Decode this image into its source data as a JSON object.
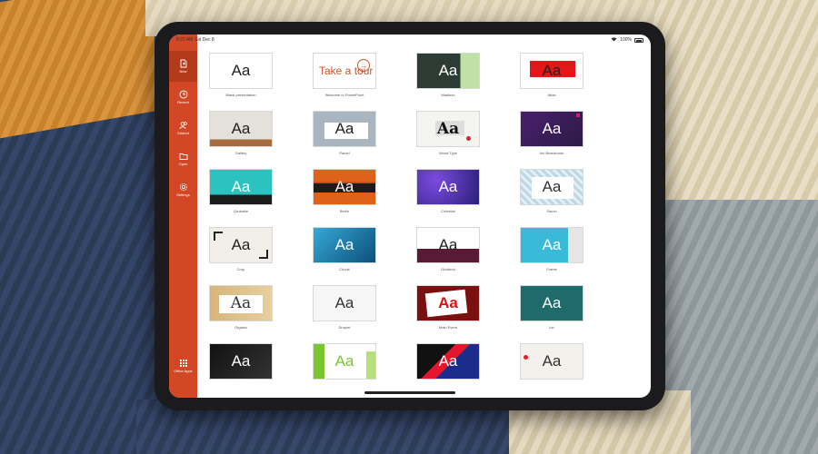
{
  "status_bar": {
    "time": "9:20 AM",
    "date": "Sat Dec 8",
    "battery": "100%"
  },
  "sidebar": {
    "items": [
      {
        "label": "New",
        "icon": "new-document-icon",
        "active": true
      },
      {
        "label": "Recent",
        "icon": "clock-icon",
        "active": false
      },
      {
        "label": "Shared",
        "icon": "people-icon",
        "active": false
      },
      {
        "label": "Open",
        "icon": "folder-icon",
        "active": false
      },
      {
        "label": "Settings",
        "icon": "gear-icon",
        "active": false
      }
    ],
    "apps_label": "Office Apps"
  },
  "templates": [
    {
      "name": "Blank presentation",
      "preview": "Aa"
    },
    {
      "name": "Welcome to PowerPoint",
      "preview": "Take a tour"
    },
    {
      "name": "Madison",
      "preview": "Aa"
    },
    {
      "name": "Atlas",
      "preview": "Aa"
    },
    {
      "name": "Gallery",
      "preview": "Aa"
    },
    {
      "name": "Parcel",
      "preview": "Aa"
    },
    {
      "name": "Wood Type",
      "preview": "Aa"
    },
    {
      "name": "Ion Boardroom",
      "preview": "Aa"
    },
    {
      "name": "Quotable",
      "preview": "Aa"
    },
    {
      "name": "Berlin",
      "preview": "Aa"
    },
    {
      "name": "Celestial",
      "preview": "Aa"
    },
    {
      "name": "Savon",
      "preview": "Aa"
    },
    {
      "name": "Crop",
      "preview": "Aa"
    },
    {
      "name": "Circuit",
      "preview": "Aa"
    },
    {
      "name": "Dividend",
      "preview": "Aa"
    },
    {
      "name": "Frame",
      "preview": "Aa"
    },
    {
      "name": "Organic",
      "preview": "Aa"
    },
    {
      "name": "Droplet",
      "preview": "Aa"
    },
    {
      "name": "Main Event",
      "preview": "Aa"
    },
    {
      "name": "Ion",
      "preview": "Aa"
    },
    {
      "name": "",
      "preview": "Aa"
    },
    {
      "name": "",
      "preview": "Aa"
    },
    {
      "name": "",
      "preview": "Aa"
    },
    {
      "name": "",
      "preview": "Aa"
    }
  ],
  "colors": {
    "sidebar": "#d24726",
    "sidebar_active": "#b53a1c",
    "accent": "#c8552c"
  }
}
